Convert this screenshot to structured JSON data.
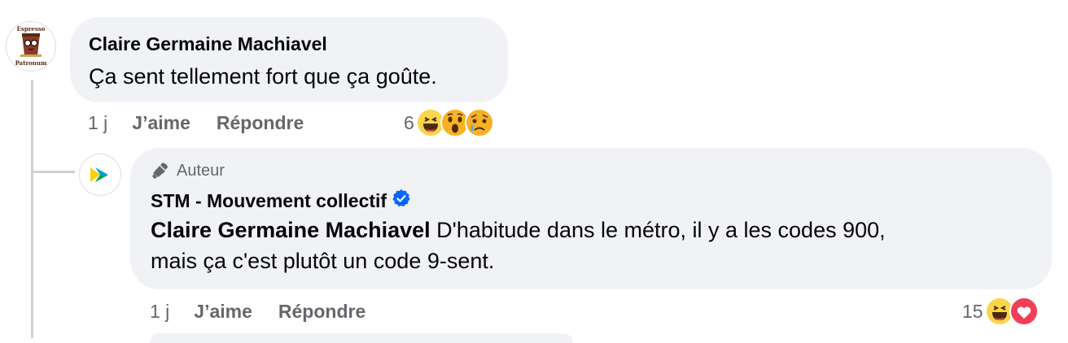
{
  "comment": {
    "avatar_text_top": "Espresso",
    "avatar_text_bottom": "Patronum",
    "author": "Claire Germaine Machiavel",
    "text": "Ça sent tellement fort que ça goûte.",
    "time": "1 j",
    "like_label": "J’aime",
    "reply_label": "Répondre",
    "reaction_count": "6",
    "reactions": [
      "haha-icon",
      "wow-icon",
      "sad-icon"
    ]
  },
  "reply": {
    "badge_label": "Auteur",
    "author": "STM - Mouvement collectif",
    "verified": true,
    "mention": "Claire Germaine Machiavel",
    "text_line1": " D'habitude dans le métro, il y a les codes 900,",
    "text_line2": "mais ça c'est plutôt un code 9-sent.",
    "time": "1 j",
    "like_label": "J’aime",
    "reply_label": "Répondre",
    "reaction_count": "15",
    "reactions": [
      "haha-icon",
      "love-icon"
    ]
  },
  "colors": {
    "bubble": "#f0f2f5",
    "secondary_text": "#65676b",
    "verified": "#0866ff",
    "love": "#f33e58",
    "emoji_yellow": "#fbd54a"
  }
}
